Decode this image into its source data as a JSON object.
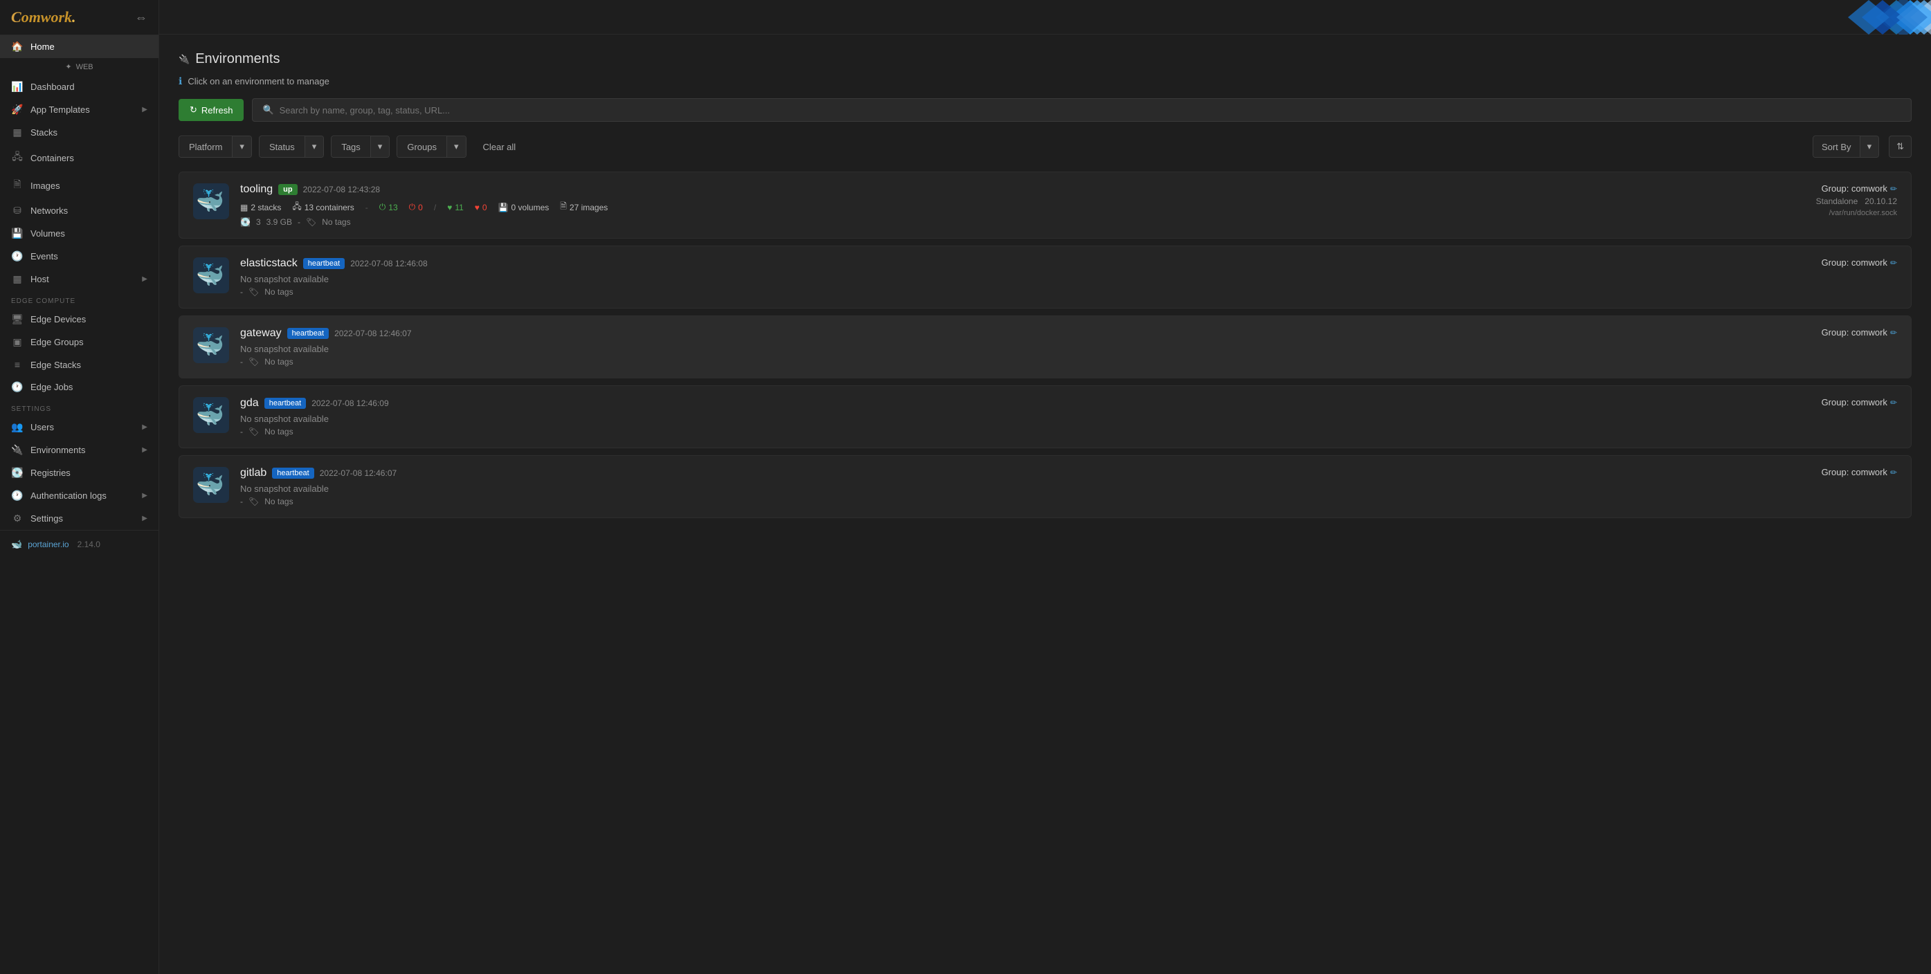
{
  "sidebar": {
    "logo": "Comwork",
    "toggle_icon": "⇔",
    "web_label": "WEB",
    "items": [
      {
        "id": "home",
        "label": "Home",
        "icon": "🏠",
        "active": true
      },
      {
        "id": "dashboard",
        "label": "Dashboard",
        "icon": "📊"
      },
      {
        "id": "app-templates",
        "label": "App Templates",
        "icon": "🚀",
        "has_arrow": true
      },
      {
        "id": "stacks",
        "label": "Stacks",
        "icon": "▦"
      },
      {
        "id": "containers",
        "label": "Containers",
        "icon": "🖧"
      },
      {
        "id": "images",
        "label": "Images",
        "icon": "🖼"
      },
      {
        "id": "networks",
        "label": "Networks",
        "icon": "🔗"
      },
      {
        "id": "volumes",
        "label": "Volumes",
        "icon": "💾"
      },
      {
        "id": "events",
        "label": "Events",
        "icon": "🕐"
      },
      {
        "id": "host",
        "label": "Host",
        "icon": "▦",
        "has_arrow": true
      }
    ],
    "edge_compute_label": "EDGE COMPUTE",
    "edge_items": [
      {
        "id": "edge-devices",
        "label": "Edge Devices",
        "icon": "🖥"
      },
      {
        "id": "edge-groups",
        "label": "Edge Groups",
        "icon": "▣"
      },
      {
        "id": "edge-stacks",
        "label": "Edge Stacks",
        "icon": "≡"
      },
      {
        "id": "edge-jobs",
        "label": "Edge Jobs",
        "icon": "🕐"
      }
    ],
    "settings_label": "SETTINGS",
    "settings_items": [
      {
        "id": "users",
        "label": "Users",
        "icon": "👥",
        "has_arrow": true
      },
      {
        "id": "environments",
        "label": "Environments",
        "icon": "🔌",
        "has_arrow": true
      },
      {
        "id": "registries",
        "label": "Registries",
        "icon": "💽"
      },
      {
        "id": "auth-logs",
        "label": "Authentication logs",
        "icon": "🕐",
        "has_arrow": true
      },
      {
        "id": "settings",
        "label": "Settings",
        "icon": "⚙",
        "has_arrow": true
      }
    ],
    "portainer_version": "2.14.0"
  },
  "topbar": {
    "diamond_colors": [
      "#1a6fa8",
      "#2196f3",
      "#64b5f6",
      "#0d47a1",
      "#1565c0",
      "#bbdefb",
      "#1976d2",
      "#42a5f5"
    ]
  },
  "page": {
    "icon": "🔌",
    "title": "Environments",
    "info_text": "Click on an environment to manage"
  },
  "toolbar": {
    "refresh_label": "Refresh",
    "search_placeholder": "Search by name, group, tag, status, URL..."
  },
  "filters": {
    "platform_label": "Platform",
    "status_label": "Status",
    "tags_label": "Tags",
    "groups_label": "Groups",
    "clear_all_label": "Clear all",
    "sort_by_label": "Sort By"
  },
  "environments": [
    {
      "id": "tooling",
      "name": "tooling",
      "badge": "up",
      "badge_type": "up",
      "timestamp": "2022-07-08 12:43:28",
      "group": "Group: comwork",
      "type": "Standalone",
      "version": "20.10.12",
      "socket": "/var/run/docker.sock",
      "stacks": "2 stacks",
      "containers": "13 containers",
      "running": "13",
      "stopped": "0",
      "healthy": "11",
      "unhealthy": "0",
      "volumes": "0 volumes",
      "images": "27 images",
      "storage_count": "3",
      "storage_size": "3.9 GB",
      "tags": "No tags",
      "no_snapshot": false
    },
    {
      "id": "elasticstack",
      "name": "elasticstack",
      "badge": "heartbeat",
      "badge_type": "heartbeat",
      "timestamp": "2022-07-08 12:46:08",
      "group": "Group: comwork",
      "no_snapshot": true,
      "snapshot_text": "No snapshot available",
      "tags": "No tags"
    },
    {
      "id": "gateway",
      "name": "gateway",
      "badge": "heartbeat",
      "badge_type": "heartbeat",
      "timestamp": "2022-07-08 12:46:07",
      "group": "Group: comwork",
      "no_snapshot": true,
      "snapshot_text": "No snapshot available",
      "tags": "No tags",
      "highlighted": true
    },
    {
      "id": "gda",
      "name": "gda",
      "badge": "heartbeat",
      "badge_type": "heartbeat",
      "timestamp": "2022-07-08 12:46:09",
      "group": "Group: comwork",
      "no_snapshot": true,
      "snapshot_text": "No snapshot available",
      "tags": "No tags"
    },
    {
      "id": "gitlab",
      "name": "gitlab",
      "badge": "heartbeat",
      "badge_type": "heartbeat",
      "timestamp": "2022-07-08 12:46:07",
      "group": "Group: comwork",
      "no_snapshot": true,
      "snapshot_text": "No snapshot available",
      "tags": "No tags"
    }
  ]
}
